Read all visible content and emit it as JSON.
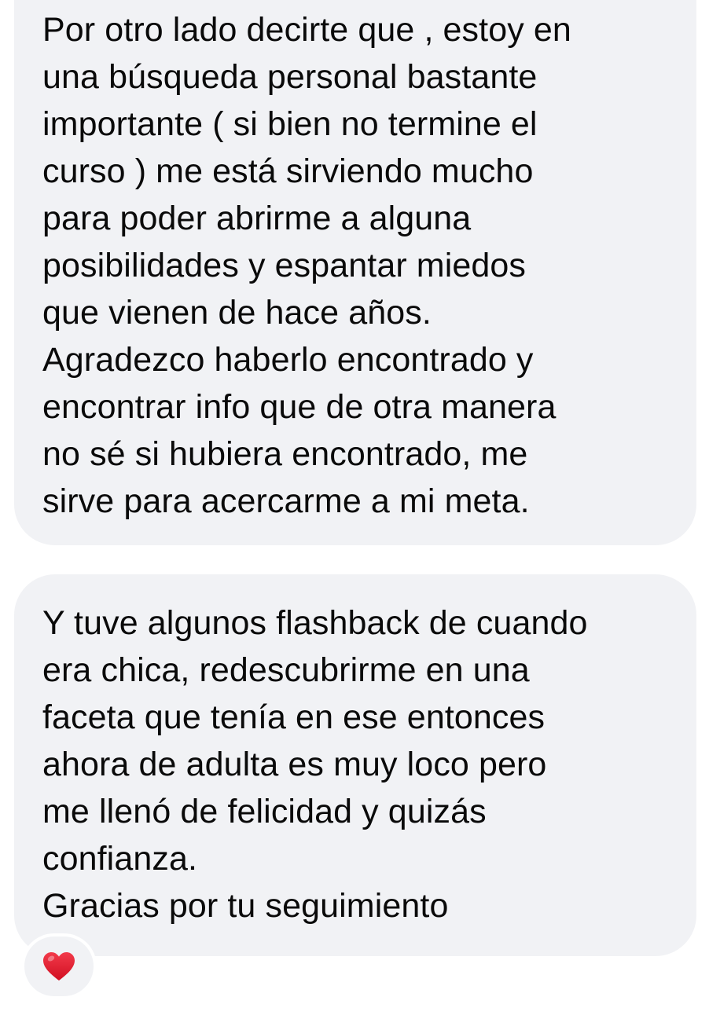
{
  "messages": [
    {
      "lines": [
        "Por otro lado decirte que , estoy en",
        "una búsqueda personal bastante",
        "importante ( si bien no termine el",
        "curso ) me está sirviendo mucho",
        "para poder abrirme a alguna",
        "posibilidades y espantar miedos",
        "que vienen de hace años.",
        "Agradezco haberlo encontrado y",
        "encontrar info que de otra manera",
        "no sé si hubiera encontrado, me",
        "sirve para acercarme a mi meta."
      ]
    },
    {
      "lines": [
        "Y tuve algunos flashback de cuando",
        "era chica, redescubrirme en una",
        "faceta que tenía en ese entonces",
        "ahora de adulta es muy loco pero",
        "me llenó de felicidad y quizás",
        "confianza.",
        "Gracias por tu seguimiento"
      ],
      "reaction": {
        "icon": "red-heart-icon",
        "color": "#e8152a"
      }
    }
  ],
  "colors": {
    "bubble_background": "#f1f2f5",
    "page_background": "#ffffff",
    "text": "#0a0a0a"
  }
}
